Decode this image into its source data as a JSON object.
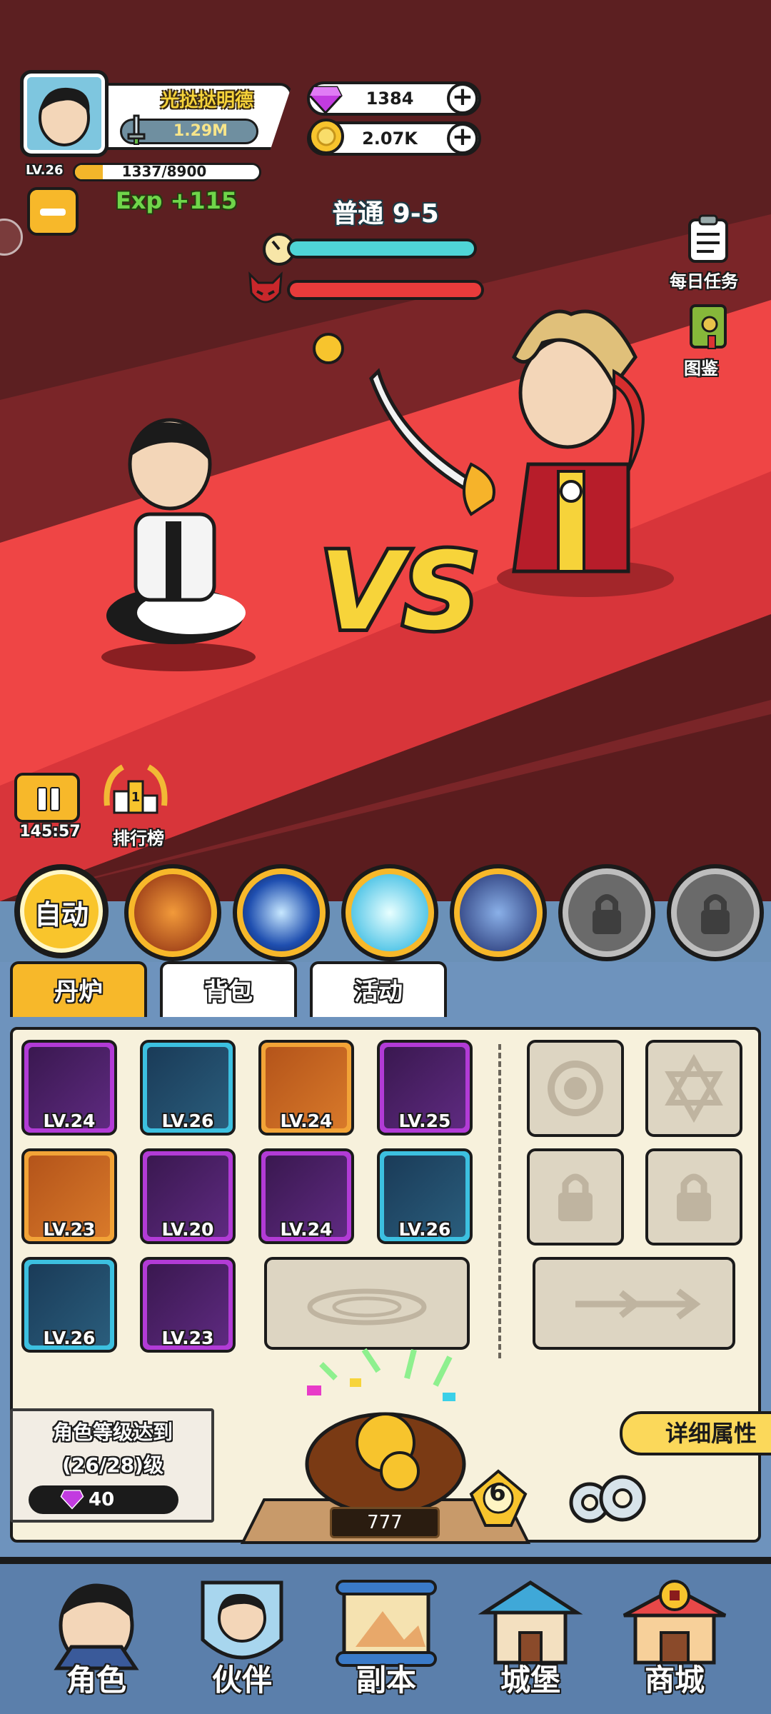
{
  "player": {
    "name": "光挞挞明德",
    "power": "1.29M",
    "level": "LV.26",
    "xp_text": "1337/8900",
    "xp_fraction": 0.15,
    "exp_gain": "Exp +115"
  },
  "currency": {
    "gems": "1384",
    "gold": "2.07K",
    "plus": "+"
  },
  "stage": {
    "name": "普通 9-5",
    "player_hp": 1.0,
    "enemy_hp": 1.0,
    "vs": "VS"
  },
  "side_menu": {
    "daily_tasks": "每日任务",
    "codex": "图鉴"
  },
  "battle_controls": {
    "timer": "145:57",
    "ranking": "排行榜"
  },
  "skills": {
    "auto": "自动",
    "items": [
      "rage-demon",
      "blue-fireball",
      "ice-spirit",
      "thunder-shield",
      "locked",
      "locked"
    ]
  },
  "tabs": [
    "丹炉",
    "背包",
    "活动"
  ],
  "equipment": [
    {
      "level": "LV.24",
      "rarity": "purple",
      "icon": "sword-icon"
    },
    {
      "level": "LV.26",
      "rarity": "blue",
      "icon": "helmet-icon"
    },
    {
      "level": "LV.24",
      "rarity": "orange",
      "icon": "armor-icon"
    },
    {
      "level": "LV.25",
      "rarity": "purple",
      "icon": "orb-icon"
    },
    {
      "level": "LV.23",
      "rarity": "orange",
      "icon": "crown-icon"
    },
    {
      "level": "LV.20",
      "rarity": "purple",
      "icon": "pendant-icon"
    },
    {
      "level": "LV.24",
      "rarity": "purple",
      "icon": "bracelet-icon"
    },
    {
      "level": "LV.26",
      "rarity": "blue",
      "icon": "crystal-icon"
    },
    {
      "level": "LV.26",
      "rarity": "blue",
      "icon": "belt-icon"
    },
    {
      "level": "LV.23",
      "rarity": "purple",
      "icon": "boots-icon"
    }
  ],
  "quest": {
    "line1": "角色等级达到",
    "line2": "(26/28)级",
    "reward": "40"
  },
  "details_button": "详细属性",
  "furnace": {
    "value": "777",
    "count": "6"
  },
  "nav": [
    "角色",
    "伙伴",
    "副本",
    "城堡",
    "商城"
  ],
  "colors": {
    "accent": "#f7b82a",
    "panel_bg": "#f7f1dc",
    "frame_blue": "#6e93bd",
    "battle_red": "#e63a3a"
  }
}
